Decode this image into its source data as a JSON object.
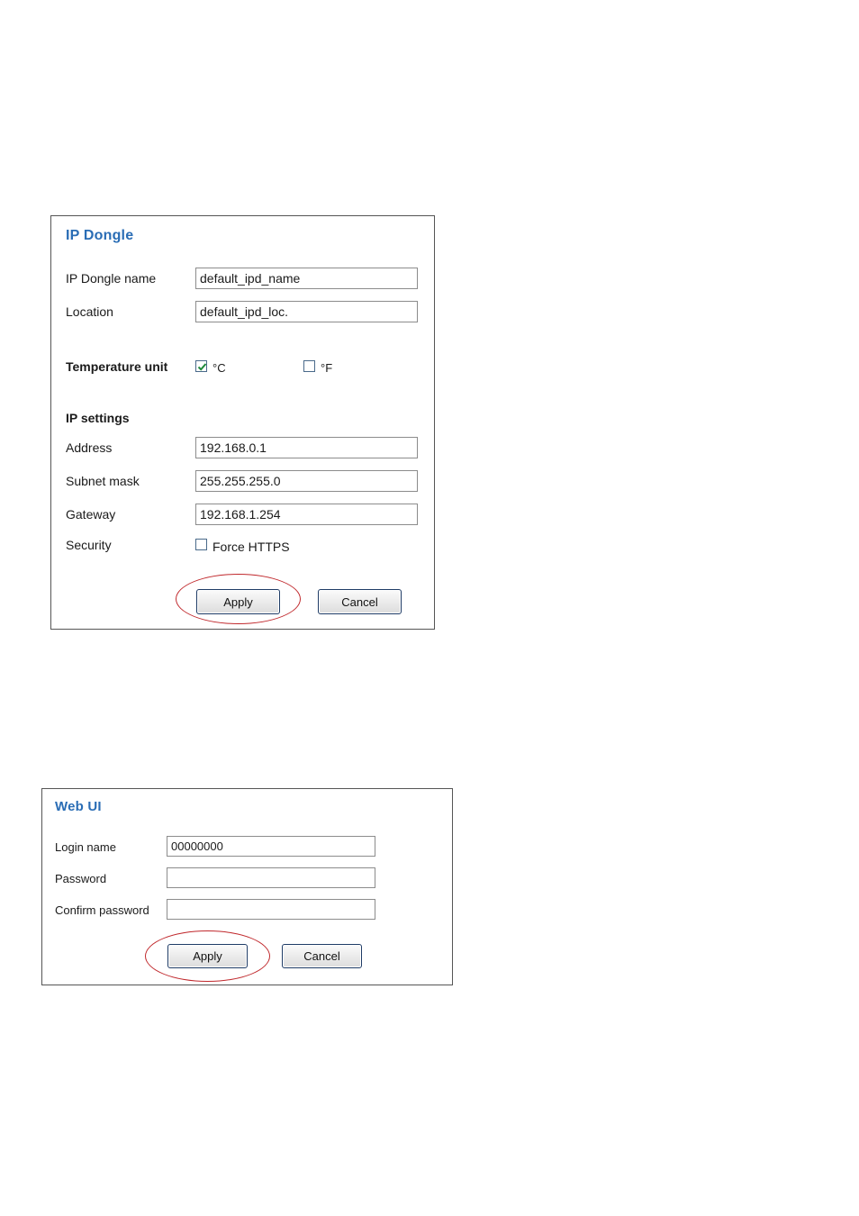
{
  "ip_dongle": {
    "title": "IP Dongle",
    "name_label": "IP Dongle name",
    "name_value": "default_ipd_name",
    "location_label": "Location",
    "location_value": "default_ipd_loc.",
    "temperature_label": "Temperature unit",
    "celsius_label": "°C",
    "celsius_checked": true,
    "fahrenheit_label": "°F",
    "fahrenheit_checked": false,
    "ip_settings_label": "IP settings",
    "address_label": "Address",
    "address_value": "192.168.0.1",
    "subnet_label": "Subnet mask",
    "subnet_value": "255.255.255.0",
    "gateway_label": "Gateway",
    "gateway_value": "192.168.1.254",
    "security_label": "Security",
    "force_https_label": "Force HTTPS",
    "force_https_checked": false,
    "apply_label": "Apply",
    "cancel_label": "Cancel"
  },
  "web_ui": {
    "title": "Web UI",
    "login_label": "Login name",
    "login_value": "00000000",
    "password_label": "Password",
    "password_value": "",
    "confirm_label": "Confirm password",
    "confirm_value": "",
    "apply_label": "Apply",
    "cancel_label": "Cancel"
  },
  "colors": {
    "title_blue": "#2a6db5",
    "highlight_ring": "#c0282c",
    "check_green": "#1e8a3a"
  },
  "icons": {
    "checkmark": "checkmark-icon"
  }
}
